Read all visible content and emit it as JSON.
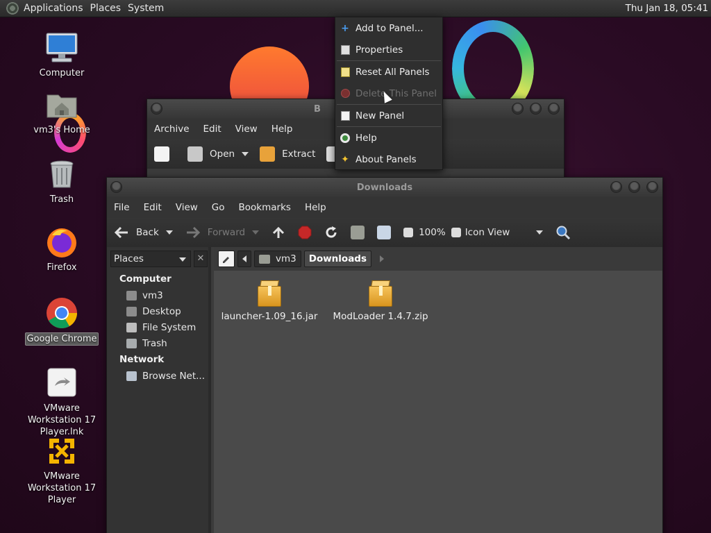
{
  "top_panel": {
    "menus": [
      "Applications",
      "Places",
      "System"
    ],
    "clock": "Thu Jan 18, 05:41"
  },
  "desktop": {
    "icons": [
      {
        "label": "Computer",
        "icon": "computer-icon"
      },
      {
        "label": "vm3's Home",
        "icon": "home-folder-icon"
      },
      {
        "label": "Trash",
        "icon": "trash-icon"
      },
      {
        "label": "Firefox",
        "icon": "firefox-icon"
      },
      {
        "label": "Google Chrome",
        "icon": "chrome-icon"
      },
      {
        "label": "VMware Workstation 17 Player.lnk",
        "icon": "shortcut-icon"
      },
      {
        "label": "VMware Workstation 17 Player",
        "icon": "vmware-icon"
      }
    ]
  },
  "archive_window": {
    "title": "B",
    "menu": [
      "Archive",
      "Edit",
      "View",
      "Help"
    ],
    "toolbar": {
      "open": "Open",
      "extract": "Extract"
    }
  },
  "context_menu": {
    "items": [
      {
        "label": "Add to Panel...",
        "icon": "plus-icon",
        "disabled": false
      },
      {
        "label": "Properties",
        "icon": "properties-icon",
        "disabled": false
      },
      {
        "label": "Reset All Panels",
        "icon": "reset-icon",
        "disabled": false
      },
      {
        "label": "Delete This Panel",
        "icon": "delete-icon",
        "disabled": true
      },
      {
        "label": "New Panel",
        "icon": "new-panel-icon",
        "disabled": false
      },
      {
        "label": "Help",
        "icon": "help-icon",
        "disabled": false
      },
      {
        "label": "About Panels",
        "icon": "about-icon",
        "disabled": false
      }
    ]
  },
  "file_manager": {
    "title": "Downloads",
    "menu": [
      "File",
      "Edit",
      "View",
      "Go",
      "Bookmarks",
      "Help"
    ],
    "toolbar": {
      "back": "Back",
      "forward": "Forward",
      "zoom": "100%",
      "view_mode": "Icon View"
    },
    "sidebar": {
      "selector": "Places",
      "close": "✕",
      "sections": [
        {
          "heading": "Computer",
          "items": [
            "vm3",
            "Desktop",
            "File System",
            "Trash"
          ]
        },
        {
          "heading": "Network",
          "items": [
            "Browse Net..."
          ]
        }
      ]
    },
    "breadcrumb": [
      "vm3",
      "Downloads"
    ],
    "files": [
      {
        "name": "launcher-1.09_16.jar",
        "icon": "package-icon"
      },
      {
        "name": "ModLoader 1.4.7.zip",
        "icon": "package-icon"
      }
    ]
  },
  "colors": {
    "wallpaper": "#2a0b24",
    "panel": "#333333",
    "content_bg": "#4a4a4a",
    "accent_orange": "#f25a3a"
  }
}
